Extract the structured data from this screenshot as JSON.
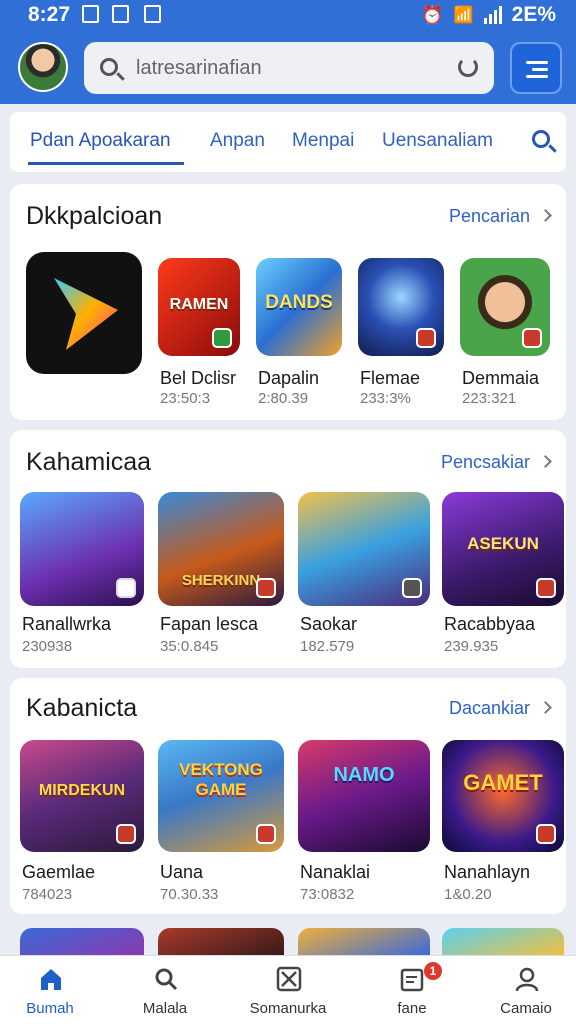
{
  "status_bar": {
    "time": "8:27",
    "battery": "2E%"
  },
  "search": {
    "placeholder": "latresarinafian"
  },
  "tabs": [
    "Pdan Apoakaran",
    "Anpan",
    "Menpai",
    "Uensanaliam"
  ],
  "sections": [
    {
      "title": "Dkkpalcioan",
      "link": "Pencarian",
      "apps": [
        {
          "name": "",
          "meta": "",
          "icon": "play-logo-icon"
        },
        {
          "name": "Bel Dclisr",
          "meta": "23:50:3",
          "icon_text": "RAMEN"
        },
        {
          "name": "Dapalin",
          "meta": "2:80.39",
          "icon_text": "DANDS"
        },
        {
          "name": "Flemae",
          "meta": "233:3%",
          "icon_text": ""
        },
        {
          "name": "Demmaia",
          "meta": "223:321",
          "icon_text": ""
        }
      ]
    },
    {
      "title": "Kahamicaa",
      "link": "Pencsakiar",
      "apps": [
        {
          "name": "Ranallwrka",
          "meta": "230938",
          "icon_text": ""
        },
        {
          "name": "Fapan lesca",
          "meta": "35:0.845",
          "icon_text": "SHERKINN"
        },
        {
          "name": "Saokar",
          "meta": "182.579",
          "icon_text": ""
        },
        {
          "name": "Racabbyaa",
          "meta": "239.935",
          "icon_text": "ASEKUN"
        }
      ]
    },
    {
      "title": "Kabanicta",
      "link": "Dacankiar",
      "apps": [
        {
          "name": "Gaemlae",
          "meta": "784023",
          "icon_text": "MIRDEKUN"
        },
        {
          "name": "Uana",
          "meta": "70.30.33",
          "icon_text": "VEKTONG GAME"
        },
        {
          "name": "Nanaklai",
          "meta": "73:0832",
          "icon_text": "NAMO"
        },
        {
          "name": "Nanahlayn",
          "meta": "1&0.20",
          "icon_text": "GAMET"
        }
      ]
    }
  ],
  "bottom_nav": [
    {
      "label": "Bumah",
      "icon": "home-icon"
    },
    {
      "label": "Malala",
      "icon": "search-icon"
    },
    {
      "label": "Somanurka",
      "icon": "games-icon"
    },
    {
      "label": "fane",
      "icon": "updates-icon",
      "badge": "1"
    },
    {
      "label": "Camaio",
      "icon": "profile-icon"
    }
  ],
  "colors": {
    "header": "#2f6fd6",
    "accent": "#2556b8",
    "badge": "#d93a2b"
  }
}
